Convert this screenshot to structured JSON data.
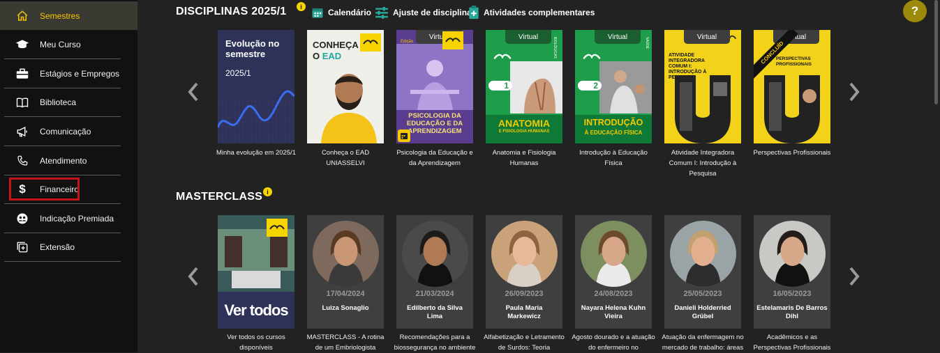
{
  "sidebar": {
    "items": [
      {
        "label": "Semestres",
        "icon": "home-icon"
      },
      {
        "label": "Meu Curso",
        "icon": "graduation-cap-icon"
      },
      {
        "label": "Estágios e Empregos",
        "icon": "briefcase-icon"
      },
      {
        "label": "Biblioteca",
        "icon": "book-icon"
      },
      {
        "label": "Comunicação",
        "icon": "megaphone-icon"
      },
      {
        "label": "Atendimento",
        "icon": "phone-icon"
      },
      {
        "label": "Financeiro",
        "icon": "dollar-icon"
      },
      {
        "label": "Indicação Premiada",
        "icon": "people-icon"
      },
      {
        "label": "Extensão",
        "icon": "add-square-icon"
      }
    ]
  },
  "disciplinas": {
    "title": "DISCIPLINAS 2025/1",
    "info": "i",
    "links": {
      "calendar": "Calendário",
      "adjust": "Ajuste de disciplina",
      "activities": "Atividades complementares"
    },
    "evolution": {
      "title_line1": "Evolução no",
      "title_line2": "semestre",
      "period": "2025/1"
    },
    "virtual_tag": "Virtual",
    "cards": [
      {
        "caption": "Minha evolução em 2025/1"
      },
      {
        "caption": "Conheça o EAD UNIASSELVI",
        "line1": "CONHEÇA",
        "line2": "O",
        "accent": "EAD"
      },
      {
        "caption": "Psicologia da Educação e da Aprendizagem",
        "cover": "PSICOLOGIA DA EDUCAÇÃO E DA APRENDIZAGEM",
        "edition": "Edição"
      },
      {
        "caption": "Anatomia e Fisiologia Humanas",
        "cover": "ANATOMIA",
        "sub": "E FISIOLOGIA HUMANAS",
        "num": "1",
        "side": "BIOLÓGICAS"
      },
      {
        "caption": "Introdução à Educação Física",
        "cover": "INTRODUÇÃO",
        "sub": "À EDUCAÇÃO FÍSICA",
        "num": "2",
        "side": "SAÚDE"
      },
      {
        "caption": "Atividade Integradora Comum I: Introdução à Pesquisa",
        "cover": "ATIVIDADE INTEGRADORA COMUM I: INTRODUÇÃO À PESQUISA"
      },
      {
        "caption": "Perspectivas Profissionais",
        "cover": "PERSPECTIVAS PROFISSIONAIS",
        "ribbon": "CONCLUÍD"
      }
    ]
  },
  "masterclass": {
    "title": "MASTERCLASS",
    "info": "i",
    "see_all": {
      "label": "Ver todos",
      "caption": "Ver todos os cursos disponíveis"
    },
    "items": [
      {
        "date": "17/04/2024",
        "name": "Luiza Sonaglio",
        "caption": "MASTERCLASS - A rotina de um Embriologista",
        "skin": "#c99775",
        "hair": "#5a3a22",
        "bg": "#7d6a5c",
        "shirt": "#3a3a3a"
      },
      {
        "date": "21/03/2024",
        "name": "Edilberto da Silva Lima",
        "caption": "Recomendações para a biossegurança no ambiente",
        "skin": "#b07a55",
        "hair": "#1e1a18",
        "bg": "#4a4a4a",
        "shirt": "#111"
      },
      {
        "date": "26/09/2023",
        "name": "Paula Maria Markewicz",
        "caption": "Alfabetização e Letramento de Surdos: Teoria",
        "skin": "#e7b89a",
        "hair": "#8a6540",
        "bg": "#c9a27a",
        "shirt": "#d9d0c5"
      },
      {
        "date": "24/08/2023",
        "name": "Nayara Helena Kuhn Vieira",
        "caption": "Agosto dourado e a atuação do enfermeiro no",
        "skin": "#d8a689",
        "hair": "#6b4a2e",
        "bg": "#7e8f5f",
        "shirt": "#eaeaea"
      },
      {
        "date": "25/05/2023",
        "name": "Danieli Holderried Grübel",
        "caption": "Atuação da enfermagem no mercado de trabalho: áreas",
        "skin": "#e2b08f",
        "hair": "#c2a070",
        "bg": "#9aa4a6",
        "shirt": "#2d2d2d"
      },
      {
        "date": "16/05/2023",
        "name": "Estelamaris De Barros Dihl",
        "caption": "Acadêmicos e as Perspectivas Profissionais",
        "skin": "#d7a78a",
        "hair": "#241c18",
        "bg": "#c8c8c4",
        "shirt": "#111"
      }
    ]
  },
  "help": {
    "label": "?"
  },
  "colors": {
    "accent": "#f5c800",
    "sidebar_bg": "#111111",
    "main_bg": "#222222",
    "highlight_border": "#c4141a"
  }
}
